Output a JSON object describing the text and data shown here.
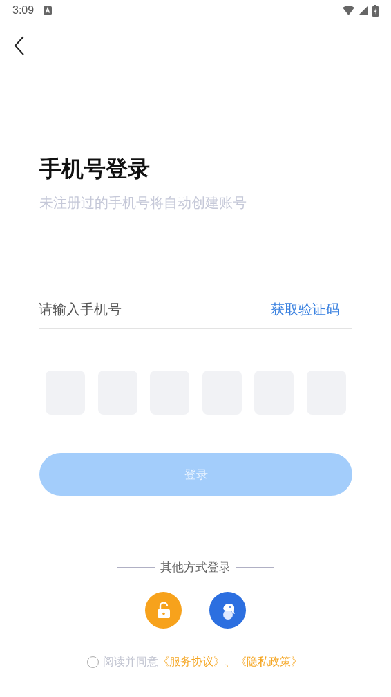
{
  "status_bar": {
    "time": "3:09"
  },
  "title": "手机号登录",
  "subtitle": "未注册过的手机号将自动创建账号",
  "phone_field": {
    "placeholder": "请输入手机号"
  },
  "get_code_link": "获取验证码",
  "code_boxes": [
    {
      "filled": false
    },
    {
      "filled": false
    },
    {
      "filled": false
    },
    {
      "filled": false
    },
    {
      "filled": false
    },
    {
      "filled": false
    }
  ],
  "login_button": {
    "label": "登录",
    "disabled": true
  },
  "other_login": {
    "label": "其他方式登录",
    "methods": [
      {
        "kind": "lock"
      },
      {
        "kind": "elephant"
      }
    ]
  },
  "agreement": {
    "checked": false,
    "text": "阅读并同意",
    "links": [
      "《服务协议》",
      "、《隐私政策》"
    ]
  }
}
